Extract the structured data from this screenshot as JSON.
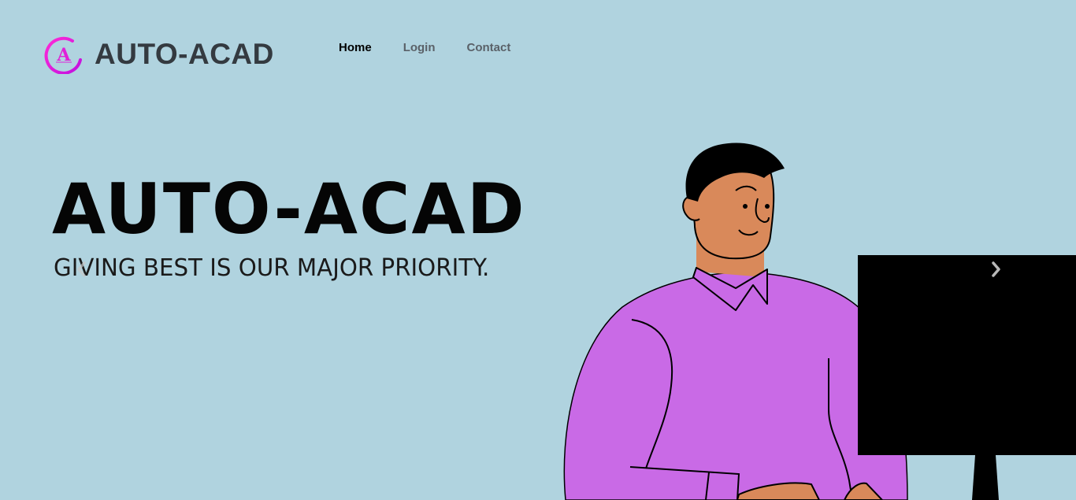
{
  "brand": {
    "name": "AUTO-ACAD",
    "logo_letter": "A",
    "logo_color": "#e020d8"
  },
  "nav": {
    "items": [
      {
        "label": "Home",
        "active": true
      },
      {
        "label": "Login",
        "active": false
      },
      {
        "label": "Contact",
        "active": false
      }
    ]
  },
  "hero": {
    "title": "AUTO-ACAD",
    "subtitle": "GIVING BEST IS OUR MAJOR PRIORITY."
  },
  "carousel": {
    "prev_icon": "chevron-left-icon",
    "next_icon": "chevron-right-icon"
  },
  "colors": {
    "background": "#b0d3df",
    "shirt": "#c96ae6",
    "skin": "#d9895a",
    "monitor": "#000000"
  }
}
